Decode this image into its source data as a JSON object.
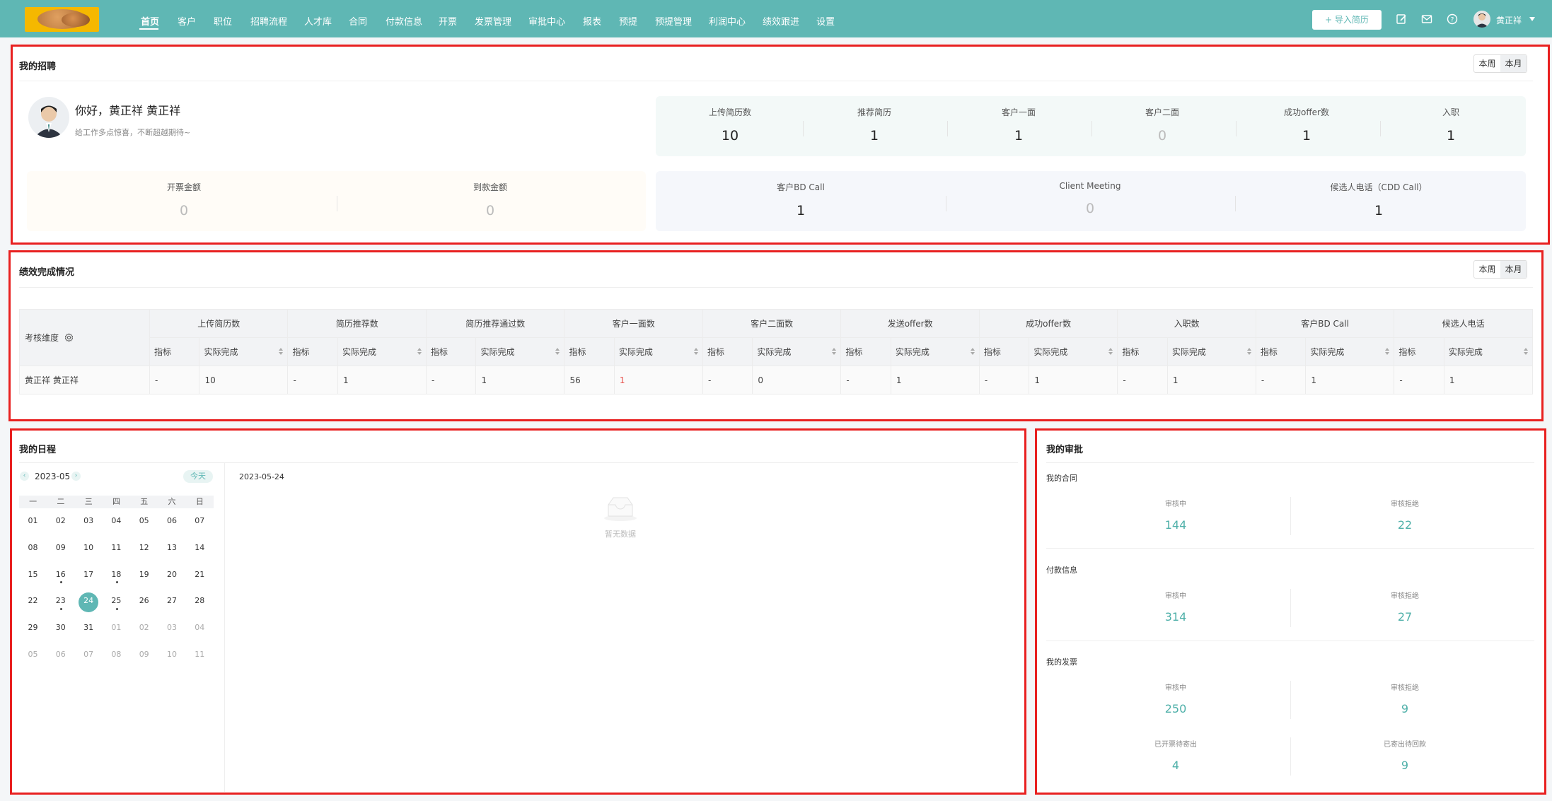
{
  "nav": {
    "items": [
      "首页",
      "客户",
      "职位",
      "招聘流程",
      "人才库",
      "合同",
      "付款信息",
      "开票",
      "发票管理",
      "审批中心",
      "报表",
      "预提",
      "预提管理",
      "利润中心",
      "绩效跟进",
      "设置"
    ],
    "import_label": "+ 导入简历",
    "user": "黄正祥"
  },
  "recruit": {
    "title": "我的招聘",
    "toggle": [
      "本周",
      "本月"
    ],
    "greeting": "你好，黄正祥 黄正祥",
    "motto": "给工作多点惊喜，不断超越期待~",
    "stats": [
      {
        "label": "上传简历数",
        "value": "10"
      },
      {
        "label": "推荐简历",
        "value": "1"
      },
      {
        "label": "客户一面",
        "value": "1"
      },
      {
        "label": "客户二面",
        "value": "0"
      },
      {
        "label": "成功offer数",
        "value": "1"
      },
      {
        "label": "入职",
        "value": "1"
      }
    ],
    "money": [
      {
        "label": "开票金额",
        "value": "0"
      },
      {
        "label": "到款金额",
        "value": "0"
      }
    ],
    "calls": [
      {
        "label": "客户BD Call",
        "value": "1"
      },
      {
        "label": "Client Meeting",
        "value": "0"
      },
      {
        "label": "候选人电话（CDD Call）",
        "value": "1"
      }
    ]
  },
  "perf": {
    "title": "绩效完成情况",
    "toggle": [
      "本周",
      "本月"
    ],
    "dim_label": "考核维度",
    "groups": [
      "上传简历数",
      "简历推荐数",
      "简历推荐通过数",
      "客户一面数",
      "客户二面数",
      "发送offer数",
      "成功offer数",
      "入职数",
      "客户BD Call",
      "候选人电话"
    ],
    "sub_target": "指标",
    "sub_actual": "实际完成",
    "row": {
      "name": "黄正祥 黄正祥",
      "cells": [
        "-",
        "10",
        "-",
        "1",
        "-",
        "1",
        "56",
        "1",
        "-",
        "0",
        "-",
        "1",
        "-",
        "1",
        "-",
        "1",
        "-",
        "1",
        "-",
        "1"
      ]
    },
    "highlight_color": "#e8534e"
  },
  "schedule": {
    "title": "我的日程",
    "month": "2023-05",
    "today_label": "今天",
    "weekdays": [
      "一",
      "二",
      "三",
      "四",
      "五",
      "六",
      "日"
    ],
    "days": [
      "01",
      "02",
      "03",
      "04",
      "05",
      "06",
      "07",
      "08",
      "09",
      "10",
      "11",
      "12",
      "13",
      "14",
      "15",
      "16",
      "17",
      "18",
      "19",
      "20",
      "21",
      "22",
      "23",
      "24",
      "25",
      "26",
      "27",
      "28",
      "29",
      "30",
      "31",
      "01",
      "02",
      "03",
      "04",
      "05",
      "06",
      "07",
      "08",
      "09",
      "10",
      "11"
    ],
    "selected_date": "2023-05-24",
    "empty_text": "暂无数据"
  },
  "approval": {
    "title": "我的审批",
    "sections": [
      {
        "label": "我的合同",
        "items": [
          {
            "label": "审核中",
            "value": "144"
          },
          {
            "label": "审核拒绝",
            "value": "22"
          }
        ]
      },
      {
        "label": "付款信息",
        "items": [
          {
            "label": "审核中",
            "value": "314"
          },
          {
            "label": "审核拒绝",
            "value": "27"
          }
        ]
      },
      {
        "label": "我的发票",
        "items": [
          {
            "label": "审核中",
            "value": "250"
          },
          {
            "label": "审核拒绝",
            "value": "9"
          },
          {
            "label": "已开票待寄出",
            "value": "4"
          },
          {
            "label": "已寄出待回款",
            "value": "9"
          }
        ]
      }
    ]
  },
  "colors": {
    "primary": "#5fb7b4",
    "highlight_border": "#e82020"
  }
}
